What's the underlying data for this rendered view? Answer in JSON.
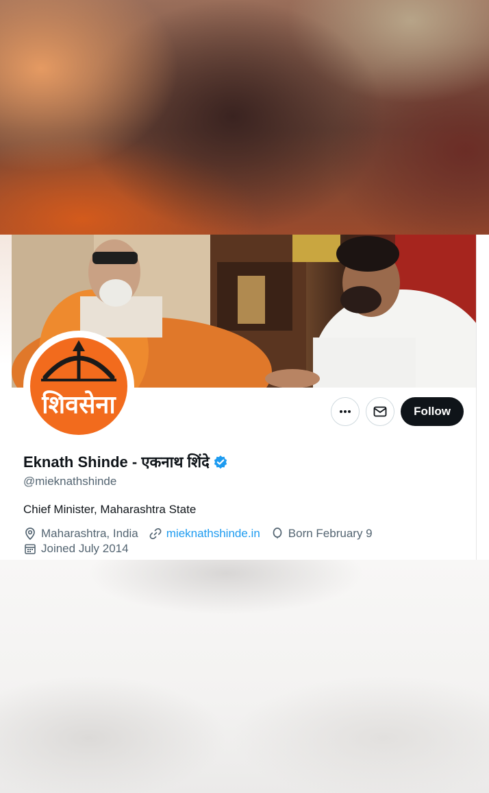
{
  "profile": {
    "display_name": "Eknath Shinde - एकनाथ शिंदे",
    "handle": "@mieknathshinde",
    "bio": "Chief Minister, Maharashtra State",
    "location": "Maharashtra, India",
    "website": "mieknathshinde.in",
    "birthday": "Born February 9",
    "joined": "Joined July 2014",
    "verified": true,
    "avatar_text": "शिवसेना"
  },
  "actions": {
    "more_icon": "more-horizontal-icon",
    "message_icon": "envelope-icon",
    "follow_label": "Follow"
  },
  "colors": {
    "accent": "#1d9bf0",
    "follow_bg": "#0f1419",
    "avatar_orange": "#f26b1d",
    "muted_text": "#536471"
  }
}
